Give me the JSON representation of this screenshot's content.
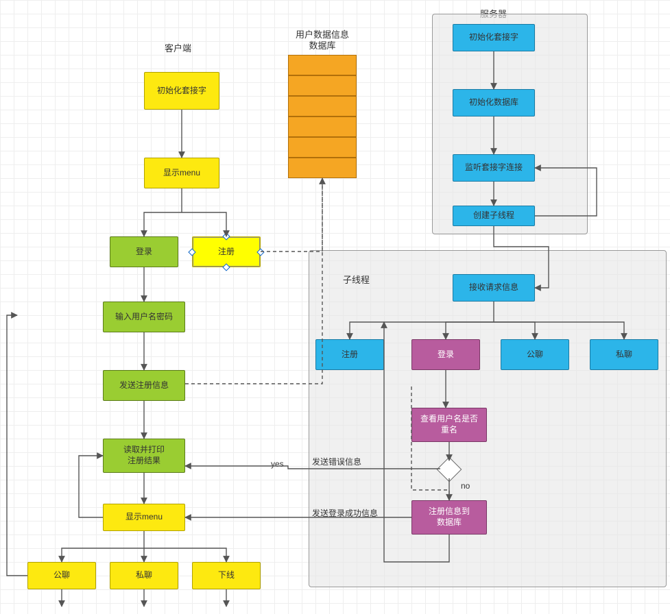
{
  "labels": {
    "client": "客户端",
    "server": "服务器",
    "subthread": "子线程",
    "userdata_l1": "用户数据信息",
    "userdata_l2": "数据库"
  },
  "client": {
    "init_socket": "初始化套接字",
    "show_menu1": "显示menu",
    "login": "登录",
    "register": "注册",
    "input_userpass": "输入用户名密码",
    "send_reg": "发送注册信息",
    "read_print": "读取并打印\n注册结果",
    "show_menu2": "显示menu",
    "public_chat": "公聊",
    "private_chat": "私聊",
    "offline": "下线"
  },
  "server": {
    "init_socket": "初始化套接字",
    "init_db": "初始化数据库",
    "listen": "监听套接字连接",
    "create_thread": "创建子线程"
  },
  "sub": {
    "recv": "接收请求信息",
    "register": "注册",
    "login": "登录",
    "public_chat": "公聊",
    "private_chat": "私聊",
    "check_dup": "查看用户名是否\n重名",
    "save_db": "注册信息到\n数据库"
  },
  "edge_labels": {
    "yes": "yes",
    "no": "no",
    "send_err": "发送错误信息",
    "send_ok": "发送登录成功信息"
  },
  "chart_data": {
    "type": "flowchart",
    "groups": [
      {
        "id": "client",
        "label": "客户端"
      },
      {
        "id": "server",
        "label": "服务器"
      },
      {
        "id": "subthread",
        "label": "子线程",
        "parent": "server"
      },
      {
        "id": "userdb",
        "label": "用户数据信息 数据库"
      }
    ],
    "nodes": [
      {
        "id": "c_init",
        "group": "client",
        "label": "初始化套接字",
        "kind": "process",
        "color": "yellow"
      },
      {
        "id": "c_menu1",
        "group": "client",
        "label": "显示menu",
        "kind": "process",
        "color": "yellow"
      },
      {
        "id": "c_login",
        "group": "client",
        "label": "登录",
        "kind": "process",
        "color": "green"
      },
      {
        "id": "c_reg",
        "group": "client",
        "label": "注册",
        "kind": "process",
        "color": "yellow",
        "selected": true
      },
      {
        "id": "c_input",
        "group": "client",
        "label": "输入用户名密码",
        "kind": "process",
        "color": "green"
      },
      {
        "id": "c_send",
        "group": "client",
        "label": "发送注册信息",
        "kind": "process",
        "color": "green"
      },
      {
        "id": "c_read",
        "group": "client",
        "label": "读取并打印 注册结果",
        "kind": "process",
        "color": "green"
      },
      {
        "id": "c_menu2",
        "group": "client",
        "label": "显示menu",
        "kind": "process",
        "color": "yellow"
      },
      {
        "id": "c_pub",
        "group": "client",
        "label": "公聊",
        "kind": "process",
        "color": "yellow"
      },
      {
        "id": "c_priv",
        "group": "client",
        "label": "私聊",
        "kind": "process",
        "color": "yellow"
      },
      {
        "id": "c_off",
        "group": "client",
        "label": "下线",
        "kind": "process",
        "color": "yellow"
      },
      {
        "id": "s_init",
        "group": "server",
        "label": "初始化套接字",
        "kind": "process",
        "color": "cyan"
      },
      {
        "id": "s_db",
        "group": "server",
        "label": "初始化数据库",
        "kind": "process",
        "color": "cyan"
      },
      {
        "id": "s_listen",
        "group": "server",
        "label": "监听套接字连接",
        "kind": "process",
        "color": "cyan"
      },
      {
        "id": "s_thread",
        "group": "server",
        "label": "创建子线程",
        "kind": "process",
        "color": "cyan"
      },
      {
        "id": "t_recv",
        "group": "subthread",
        "label": "接收请求信息",
        "kind": "process",
        "color": "cyan"
      },
      {
        "id": "t_reg",
        "group": "subthread",
        "label": "注册",
        "kind": "process",
        "color": "cyan"
      },
      {
        "id": "t_login",
        "group": "subthread",
        "label": "登录",
        "kind": "process",
        "color": "purple"
      },
      {
        "id": "t_pub",
        "group": "subthread",
        "label": "公聊",
        "kind": "process",
        "color": "cyan"
      },
      {
        "id": "t_priv",
        "group": "subthread",
        "label": "私聊",
        "kind": "process",
        "color": "cyan"
      },
      {
        "id": "t_check",
        "group": "subthread",
        "label": "查看用户名是否重名",
        "kind": "process",
        "color": "purple"
      },
      {
        "id": "t_dec",
        "group": "subthread",
        "label": "",
        "kind": "decision"
      },
      {
        "id": "t_save",
        "group": "subthread",
        "label": "注册信息到数据库",
        "kind": "process",
        "color": "purple"
      },
      {
        "id": "udb",
        "group": "userdb",
        "label": "用户数据信息 数据库",
        "kind": "datastore",
        "color": "orange"
      }
    ],
    "edges": [
      {
        "from": "c_init",
        "to": "c_menu1"
      },
      {
        "from": "c_menu1",
        "to": "c_login"
      },
      {
        "from": "c_menu1",
        "to": "c_reg"
      },
      {
        "from": "c_login",
        "to": "c_input"
      },
      {
        "from": "c_input",
        "to": "c_send"
      },
      {
        "from": "c_send",
        "to": "c_read"
      },
      {
        "from": "c_read",
        "to": "c_menu2"
      },
      {
        "from": "c_menu2",
        "to": "c_pub"
      },
      {
        "from": "c_menu2",
        "to": "c_priv"
      },
      {
        "from": "c_menu2",
        "to": "c_off"
      },
      {
        "from": "c_menu2",
        "to": "c_read",
        "style": "loopback"
      },
      {
        "from": "s_init",
        "to": "s_db"
      },
      {
        "from": "s_db",
        "to": "s_listen"
      },
      {
        "from": "s_listen",
        "to": "s_thread"
      },
      {
        "from": "s_thread",
        "to": "s_listen",
        "style": "loopback"
      },
      {
        "from": "s_thread",
        "to": "t_recv",
        "style": "cross-group"
      },
      {
        "from": "t_recv",
        "to": "t_reg"
      },
      {
        "from": "t_recv",
        "to": "t_login"
      },
      {
        "from": "t_recv",
        "to": "t_pub"
      },
      {
        "from": "t_recv",
        "to": "t_priv"
      },
      {
        "from": "t_login",
        "to": "t_check"
      },
      {
        "from": "t_check",
        "to": "t_dec"
      },
      {
        "from": "t_dec",
        "to": "c_read",
        "label": "yes  发送错误信息"
      },
      {
        "from": "t_dec",
        "to": "t_save",
        "label": "no"
      },
      {
        "from": "t_save",
        "to": "c_menu2",
        "label": "发送登录成功信息"
      },
      {
        "from": "t_save",
        "to": "t_recv",
        "style": "loopback"
      },
      {
        "from": "t_save",
        "to": "udb",
        "style": "dashed"
      },
      {
        "from": "c_reg",
        "to": "udb",
        "style": "dashed"
      }
    ]
  }
}
